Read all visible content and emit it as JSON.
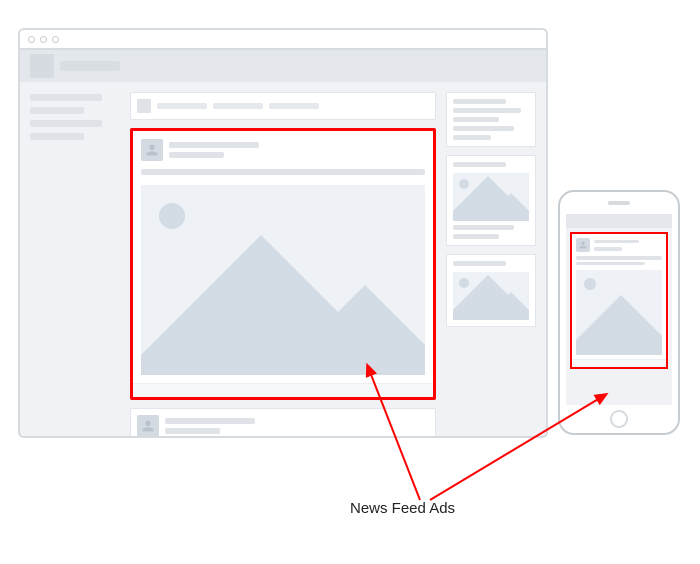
{
  "annotation": {
    "label": "News Feed Ads"
  }
}
